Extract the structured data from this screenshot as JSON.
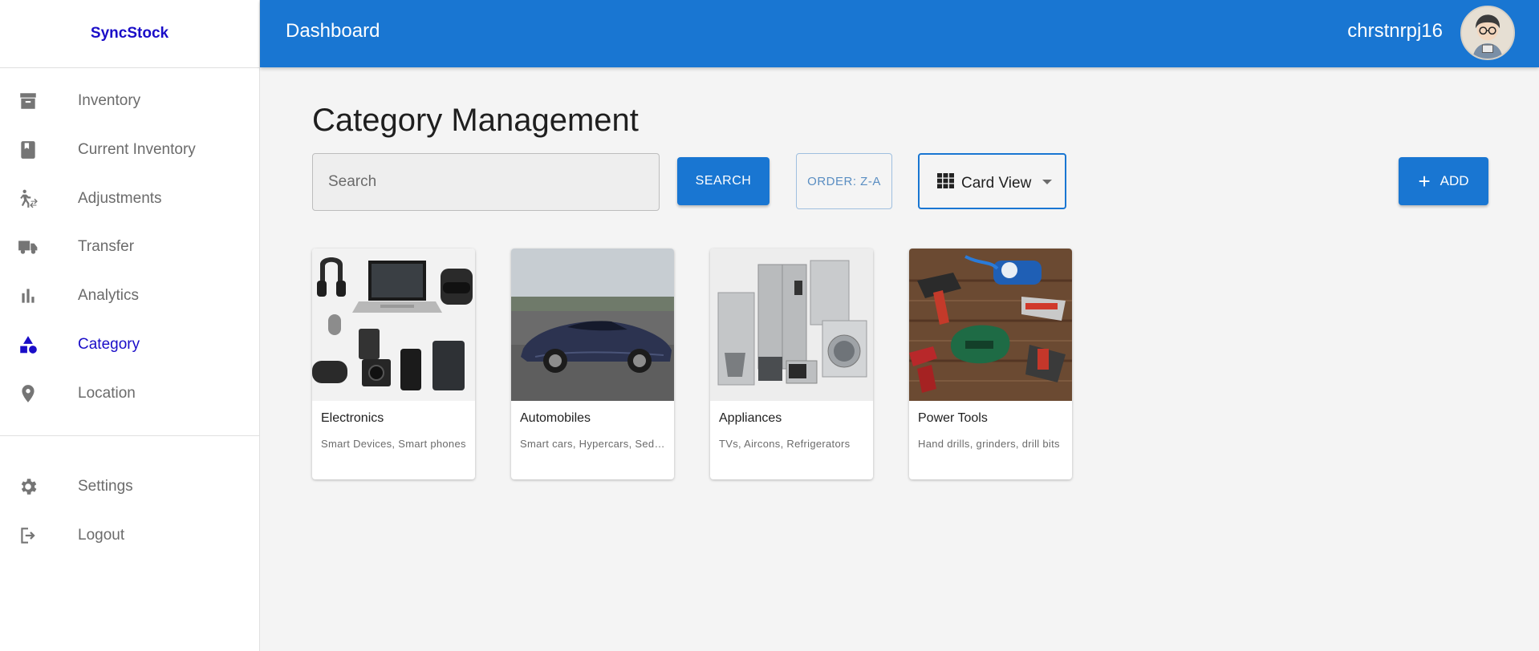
{
  "brand": {
    "name": "SyncStock"
  },
  "sidebar": {
    "items": [
      {
        "label": "Inventory",
        "icon": "archive-icon"
      },
      {
        "label": "Current Inventory",
        "icon": "book-icon"
      },
      {
        "label": "Adjustments",
        "icon": "person-transfer-icon"
      },
      {
        "label": "Transfer",
        "icon": "truck-icon"
      },
      {
        "label": "Analytics",
        "icon": "bar-chart-icon"
      },
      {
        "label": "Category",
        "icon": "category-icon",
        "active": true
      },
      {
        "label": "Location",
        "icon": "map-pin-icon"
      }
    ],
    "bottom_items": [
      {
        "label": "Settings",
        "icon": "gear-icon"
      },
      {
        "label": "Logout",
        "icon": "logout-icon"
      }
    ]
  },
  "header": {
    "title": "Dashboard",
    "username": "chrstnrpj16"
  },
  "main": {
    "title": "Category Management",
    "search": {
      "placeholder": "Search",
      "value": ""
    },
    "search_label": "SEARCH",
    "order_label": "ORDER: Z-A",
    "view_select": {
      "selected": "Card View"
    },
    "add_label": "ADD"
  },
  "categories": [
    {
      "title": "Electronics",
      "description": "Smart Devices, Smart phones"
    },
    {
      "title": "Automobiles",
      "description": "Smart cars, Hypercars, Sedans"
    },
    {
      "title": "Appliances",
      "description": "TVs, Aircons, Refrigerators"
    },
    {
      "title": "Power Tools",
      "description": "Hand drills, grinders, drill bits"
    }
  ],
  "colors": {
    "primary": "#1976d2",
    "brand": "#1a0dc8",
    "sidebar_text": "#6b6b6b",
    "background": "#f4f4f4"
  }
}
